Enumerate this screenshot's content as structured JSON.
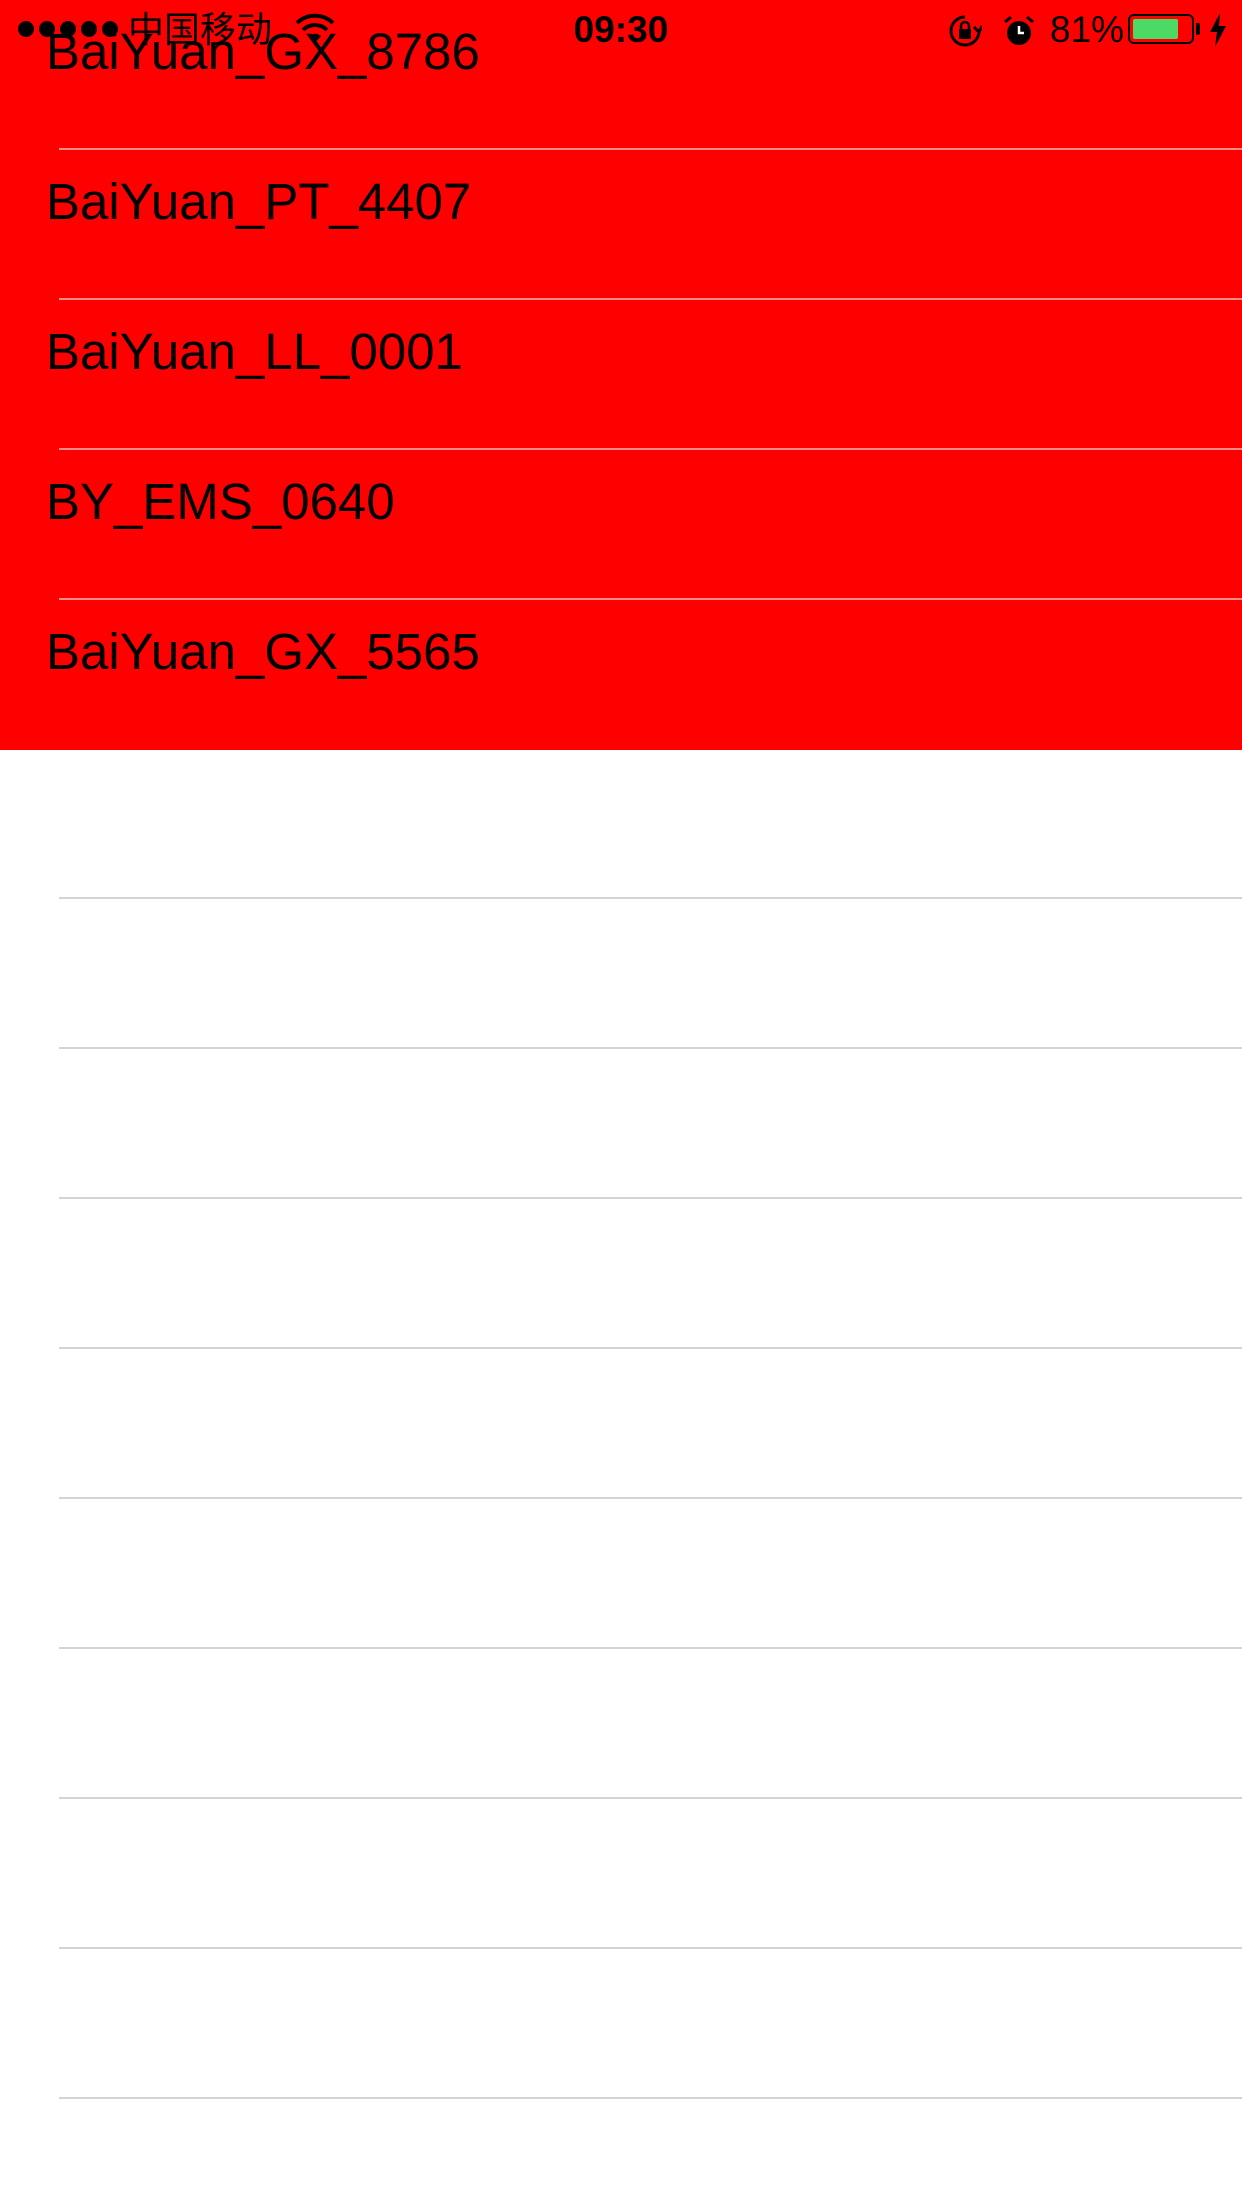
{
  "status_bar": {
    "carrier": "中国移动",
    "time": "09:30",
    "battery_percent": "81%",
    "battery_level": 0.81,
    "icons": [
      "signal-dots-icon",
      "wifi-icon",
      "rotation-lock-icon",
      "alarm-icon",
      "battery-icon",
      "charging-bolt-icon"
    ]
  },
  "list": {
    "highlight_color": "#ff0000",
    "items": [
      {
        "label": "BaiYuan_GX_8786"
      },
      {
        "label": "BaiYuan_PT_4407"
      },
      {
        "label": "BaiYuan_LL_0001"
      },
      {
        "label": "BY_EMS_0640"
      },
      {
        "label": "BaiYuan_GX_5565"
      }
    ]
  }
}
